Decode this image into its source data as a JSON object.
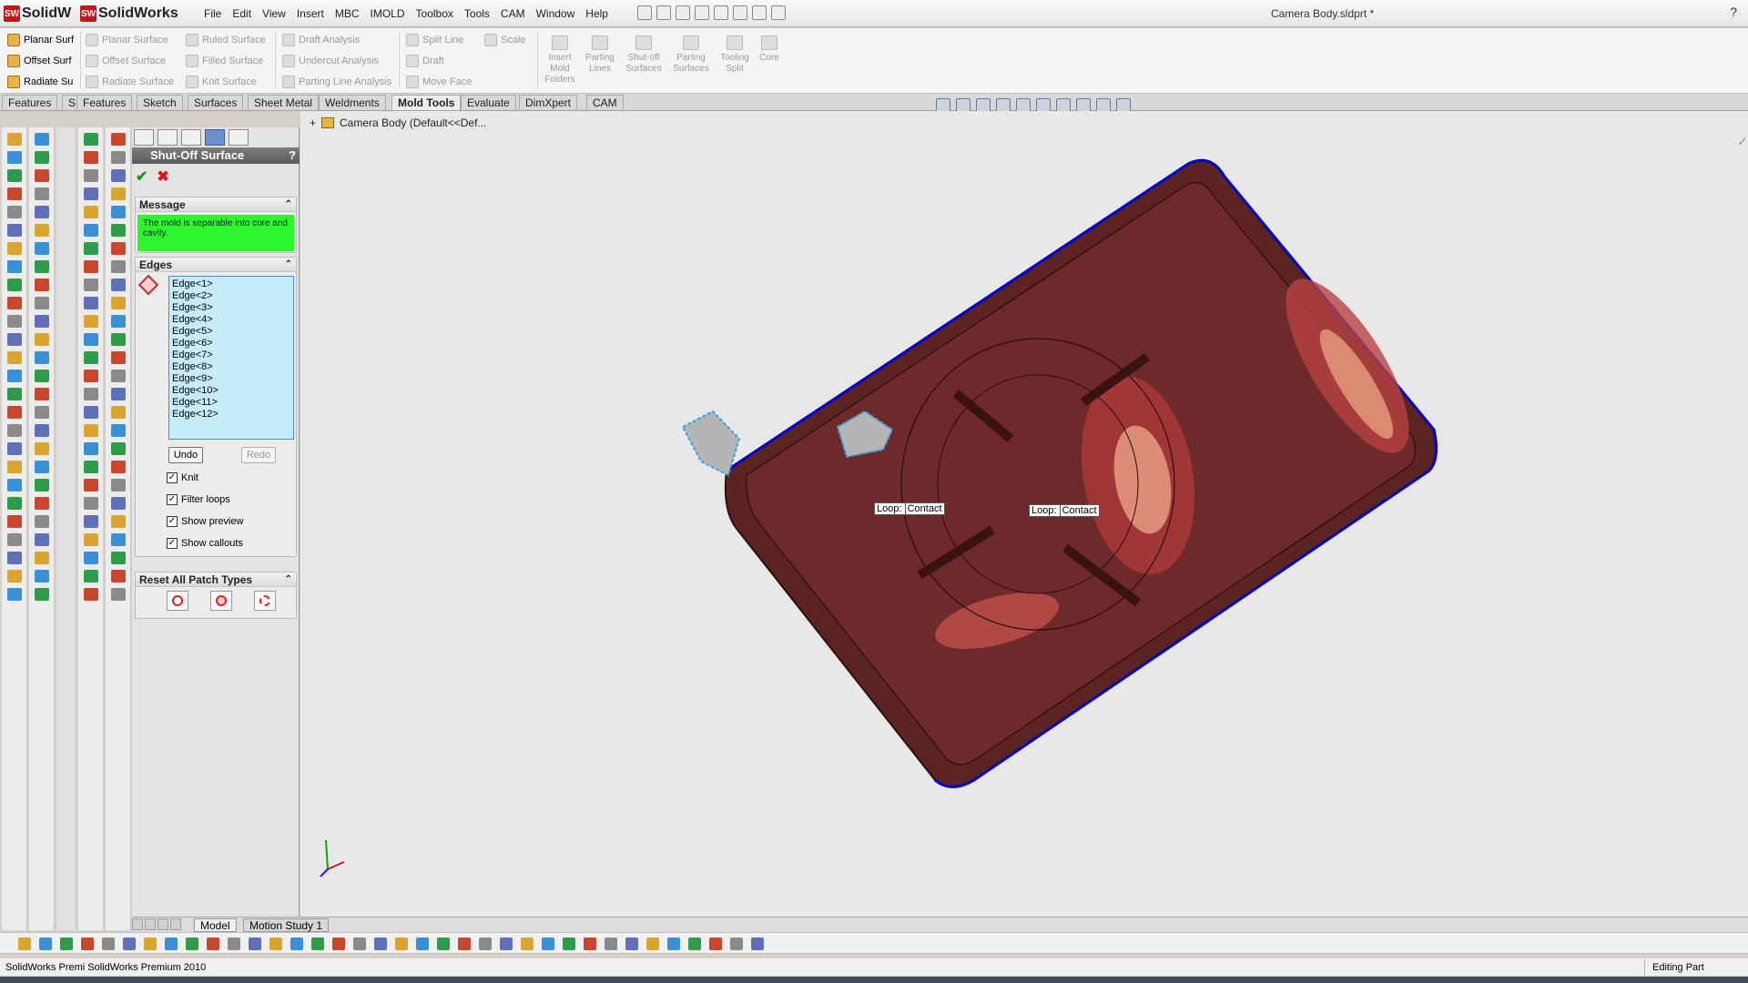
{
  "app": {
    "logo_text": "SolidWorks",
    "logo_text_cut": "SolidW",
    "logo_letters": "SW",
    "document_title": "Camera Body.sldprt *",
    "help_glyph": "?"
  },
  "menu": [
    "File",
    "Edit",
    "View",
    "Insert",
    "MBC",
    "IMOLD",
    "Toolbox",
    "Tools",
    "CAM",
    "Window",
    "Help"
  ],
  "ribbon": {
    "col1": [
      "Planar Surf",
      "Offset Surf",
      "Radiate Su"
    ],
    "col2": [
      "Planar Surface",
      "Offset Surface",
      "Radiate Surface"
    ],
    "col3": [
      "Ruled Surface",
      "Filled Surface",
      "Knit Surface"
    ],
    "col4": [
      "Draft Analysis",
      "Undercut Analysis",
      "Parting Line Analysis"
    ],
    "col5": [
      "Split Line",
      "Draft",
      "Move Face"
    ],
    "col6": [
      "Scale"
    ],
    "big": [
      "Insert Mold Folders",
      "Parting Lines",
      "Shut-off Surfaces",
      "Parting Surfaces",
      "Tooling Split",
      "Core"
    ]
  },
  "tabs": [
    "Features",
    "S",
    "Features",
    "Sketch",
    "Surfaces",
    "Sheet Metal",
    "Weldments",
    "Mold Tools",
    "Evaluate",
    "DimXpert",
    "CAM"
  ],
  "active_tab": "Mold Tools",
  "property_manager": {
    "title": "Shut-Off Surface",
    "help": "?",
    "ok_glyph": "✔",
    "cancel_glyph": "✖",
    "message_header": "Message",
    "message_text": "The mold is separable into core and cavity.",
    "message_color": "#2ff52f",
    "edges_header": "Edges",
    "edges": [
      "Edge<1>",
      "Edge<2>",
      "Edge<3>",
      "Edge<4>",
      "Edge<5>",
      "Edge<6>",
      "Edge<7>",
      "Edge<8>",
      "Edge<9>",
      "Edge<10>",
      "Edge<11>",
      "Edge<12>"
    ],
    "undo_label": "Undo",
    "redo_label": "Redo",
    "options": [
      {
        "label": "Knit",
        "checked": true
      },
      {
        "label": "Filter loops",
        "checked": true
      },
      {
        "label": "Show preview",
        "checked": true
      },
      {
        "label": "Show callouts",
        "checked": true
      }
    ],
    "reset_header": "Reset All Patch Types"
  },
  "graphics": {
    "tree_label": "Camera Body  (Default<<Def...",
    "callout_1": "Loop:",
    "callout_1b": "Contact",
    "callout_2": "Loop:",
    "callout_2b": "Contact",
    "part_color": "#6b2a2a",
    "edge_color": "#0000cc"
  },
  "bottom_tabs": [
    "Model",
    "Motion Study 1"
  ],
  "status": {
    "left": "SolidWorks Premi SolidWorks Premium 2010",
    "right": "Editing Part"
  }
}
